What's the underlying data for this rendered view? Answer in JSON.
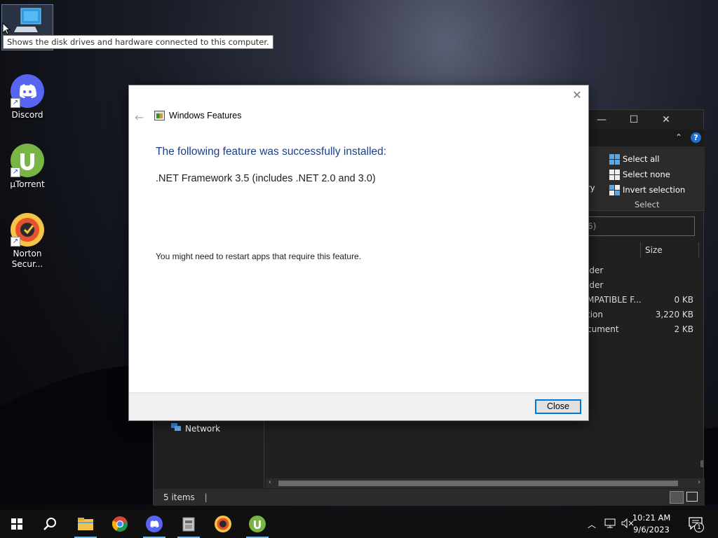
{
  "tooltip": "Shows the disk drives and hardware connected to this computer.",
  "desktop_icons": [
    {
      "label": "Discord"
    },
    {
      "label": "µTorrent"
    },
    {
      "label": "Norton Secur..."
    }
  ],
  "explorer": {
    "ribbon": {
      "select_all": "Select all",
      "select_none": "Select none",
      "invert_selection": "Invert selection",
      "group_label": "Select",
      "partial_left": "ry"
    },
    "search_placeholder": "6)",
    "column_size": "Size",
    "rows": [
      {
        "type": "lder",
        "size": ""
      },
      {
        "type": "lder",
        "size": ""
      },
      {
        "type": "MPATIBLE F...",
        "size": "0 KB"
      },
      {
        "type": "tion",
        "size": "3,220 KB"
      },
      {
        "type": "cument",
        "size": "2 KB"
      }
    ],
    "nav_network": "Network",
    "status_items": "5 items"
  },
  "dialog": {
    "title": "Windows Features",
    "heading": "The following feature was successfully installed:",
    "feature": ".NET Framework 3.5 (includes .NET 2.0 and 3.0)",
    "note": "You might need to restart apps that require this feature.",
    "close_button": "Close"
  },
  "taskbar": {
    "time": "10:21 AM",
    "date": "9/6/2023",
    "notification_count": "1",
    "apps": [
      "start-icon",
      "search-icon",
      "file-explorer-icon",
      "chrome-icon",
      "discord-icon",
      "app-installer-icon",
      "norton-icon",
      "utorrent-icon"
    ]
  },
  "colors": {
    "dialog_heading": "#1a3f8a",
    "accent": "#0078d7",
    "explorer_bg": "#202020",
    "taskbar_bg": "#101010"
  }
}
